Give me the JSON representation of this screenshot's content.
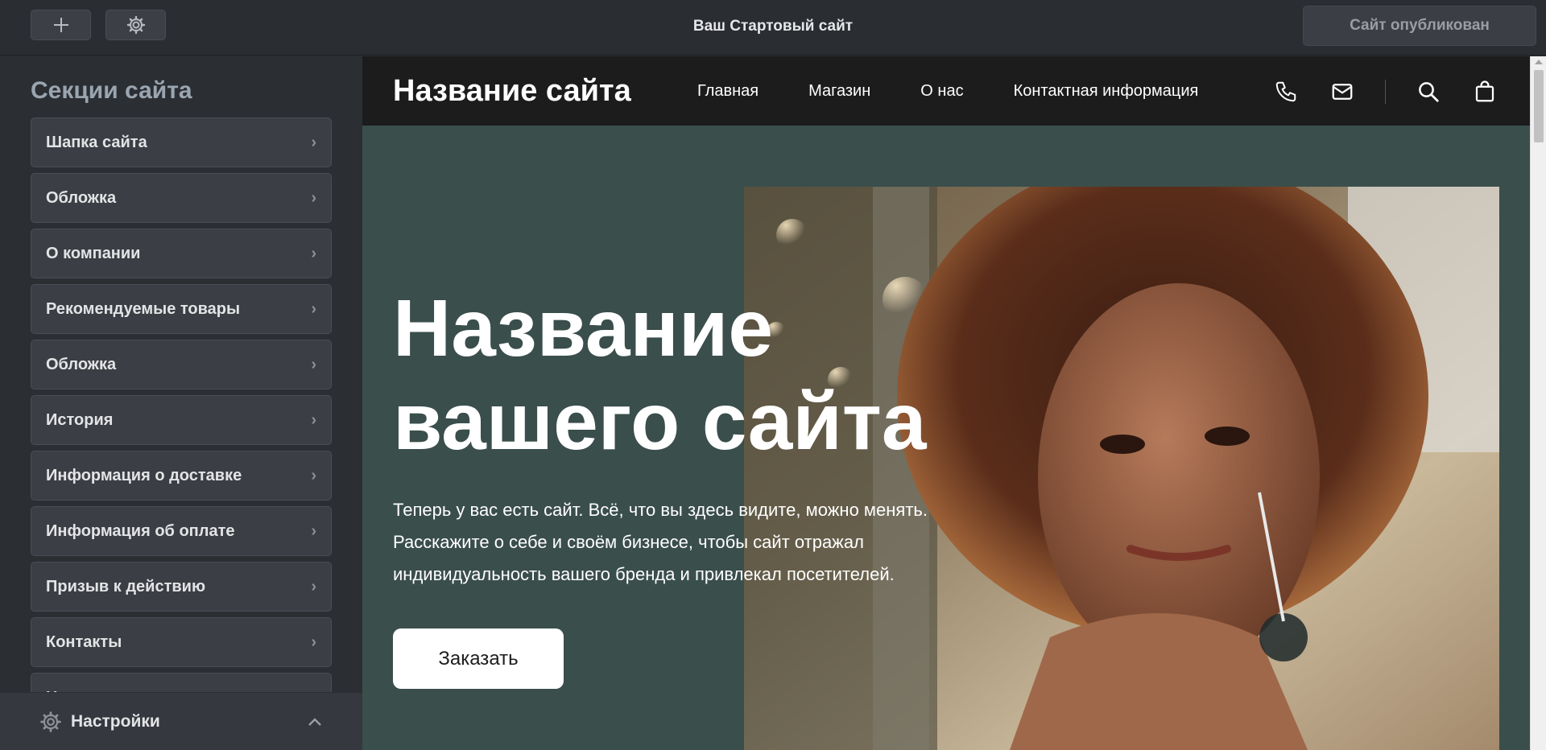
{
  "toolbar": {
    "title": "Ваш Стартовый сайт",
    "publish_label": "Сайт опубликован",
    "add_icon": "plus-icon",
    "settings_icon": "gear-icon"
  },
  "sidebar": {
    "title": "Секции сайта",
    "items": [
      {
        "label": "Шапка сайта"
      },
      {
        "label": "Обложка"
      },
      {
        "label": "О компании"
      },
      {
        "label": "Рекомендуемые товары"
      },
      {
        "label": "Обложка"
      },
      {
        "label": "История"
      },
      {
        "label": "Информация о доставке"
      },
      {
        "label": "Информация об оплате"
      },
      {
        "label": "Призыв к действию"
      },
      {
        "label": "Контакты"
      },
      {
        "label": "Нижняя панель"
      }
    ],
    "footer_label": "Настройки"
  },
  "site": {
    "name": "Название сайта",
    "nav": [
      "Главная",
      "Магазин",
      "О нас",
      "Контактная информация"
    ],
    "icons": [
      "phone-icon",
      "mail-icon",
      "search-icon",
      "bag-icon"
    ],
    "hero_title_line1": "Название",
    "hero_title_line2": "вашего сайта",
    "hero_text": "Теперь у вас есть сайт. Всё, что вы здесь видите, можно менять. Расскажите о себе и своём бизнесе, чтобы сайт отражал индивидуальность вашего бренда и привлекал посетителей.",
    "cta_label": "Заказать"
  },
  "colors": {
    "toolbar_bg": "#2a2d32",
    "sidebar_item_bg": "#3b3e44",
    "site_header_bg": "#1c1c1d",
    "hero_bg": "#3a4e4c"
  }
}
